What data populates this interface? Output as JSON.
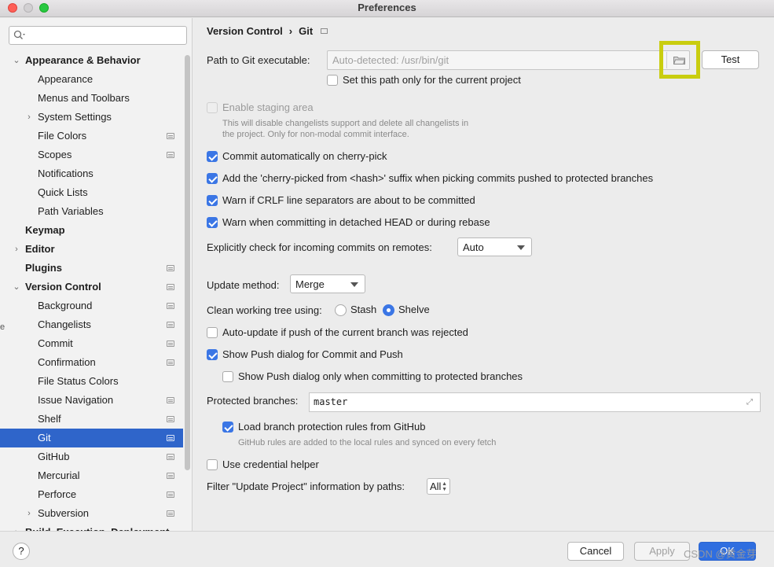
{
  "window": {
    "title": "Preferences"
  },
  "sidebar": {
    "search_placeholder": "",
    "items": [
      {
        "label": "Appearance & Behavior",
        "level": 0,
        "bold": true,
        "arrow": "expanded"
      },
      {
        "label": "Appearance",
        "level": 1
      },
      {
        "label": "Menus and Toolbars",
        "level": 1
      },
      {
        "label": "System Settings",
        "level": 1,
        "arrow": "collapsed"
      },
      {
        "label": "File Colors",
        "level": 1,
        "badge": true
      },
      {
        "label": "Scopes",
        "level": 1,
        "badge": true
      },
      {
        "label": "Notifications",
        "level": 1
      },
      {
        "label": "Quick Lists",
        "level": 1
      },
      {
        "label": "Path Variables",
        "level": 1
      },
      {
        "label": "Keymap",
        "level": 0,
        "bold": true
      },
      {
        "label": "Editor",
        "level": 0,
        "bold": true,
        "arrow": "collapsed"
      },
      {
        "label": "Plugins",
        "level": 0,
        "bold": true,
        "badge": true
      },
      {
        "label": "Version Control",
        "level": 0,
        "bold": true,
        "arrow": "expanded",
        "badge": true
      },
      {
        "label": "Background",
        "level": 1,
        "badge": true
      },
      {
        "label": "Changelists",
        "level": 1,
        "badge": true
      },
      {
        "label": "Commit",
        "level": 1,
        "badge": true
      },
      {
        "label": "Confirmation",
        "level": 1,
        "badge": true
      },
      {
        "label": "File Status Colors",
        "level": 1
      },
      {
        "label": "Issue Navigation",
        "level": 1,
        "badge": true
      },
      {
        "label": "Shelf",
        "level": 1,
        "badge": true
      },
      {
        "label": "Git",
        "level": 1,
        "badge": true,
        "selected": true
      },
      {
        "label": "GitHub",
        "level": 1,
        "badge": true
      },
      {
        "label": "Mercurial",
        "level": 1,
        "badge": true
      },
      {
        "label": "Perforce",
        "level": 1,
        "badge": true
      },
      {
        "label": "Subversion",
        "level": 1,
        "arrow": "collapsed",
        "badge": true
      },
      {
        "label": "Build, Execution, Deployment",
        "level": 0,
        "bold": true,
        "arrow": "collapsed"
      }
    ]
  },
  "breadcrumb": {
    "parent": "Version Control",
    "separator": "›",
    "current": "Git"
  },
  "git": {
    "path_label": "Path to Git executable:",
    "path_placeholder": "Auto-detected: /usr/bin/git",
    "test_label": "Test",
    "path_project_only": {
      "label": "Set this path only for the current project",
      "checked": false
    },
    "staging": {
      "label": "Enable staging area",
      "checked": false,
      "disabled": true
    },
    "staging_hint_1": "This will disable changelists support and delete all changelists in",
    "staging_hint_2": "the project. Only for non-modal commit interface.",
    "commit_cherry_pick": {
      "label": "Commit automatically on cherry-pick",
      "checked": true
    },
    "cherry_suffix": {
      "label": "Add the 'cherry-picked from <hash>' suffix when picking commits pushed to protected branches",
      "checked": true
    },
    "warn_crlf": {
      "label": "Warn if CRLF line separators are about to be committed",
      "checked": true
    },
    "warn_detached": {
      "label": "Warn when committing in detached HEAD or during rebase",
      "checked": true
    },
    "incoming_label": "Explicitly check for incoming commits on remotes:",
    "incoming_value": "Auto",
    "update_method_label": "Update method:",
    "update_method_value": "Merge",
    "clean_tree_label": "Clean working tree using:",
    "clean_options": {
      "stash": "Stash",
      "shelve": "Shelve",
      "selected": "Shelve"
    },
    "auto_update": {
      "label": "Auto-update if push of the current branch was rejected",
      "checked": false
    },
    "show_push": {
      "label": "Show Push dialog for Commit and Push",
      "checked": true
    },
    "show_push_protected": {
      "label": "Show Push dialog only when committing to protected branches",
      "checked": false
    },
    "protected_label": "Protected branches:",
    "protected_value": "master",
    "load_rules": {
      "label": "Load branch protection rules from GitHub",
      "checked": true
    },
    "load_rules_hint": "GitHub rules are added to the local rules and synced on every fetch",
    "credential_helper": {
      "label": "Use credential helper",
      "checked": false
    },
    "filter_label": "Filter \"Update Project\" information by paths:",
    "filter_value": "All"
  },
  "footer": {
    "help_label": "?",
    "cancel_label": "Cancel",
    "apply_label": "Apply",
    "ok_label": "OK",
    "watermark": "CSDN @黄金芽"
  },
  "colors": {
    "selection": "#2f65ca",
    "checkbox": "#3b76e5",
    "highlight_box": "#c9cd0f",
    "ok_button": "#2f6ee0"
  }
}
